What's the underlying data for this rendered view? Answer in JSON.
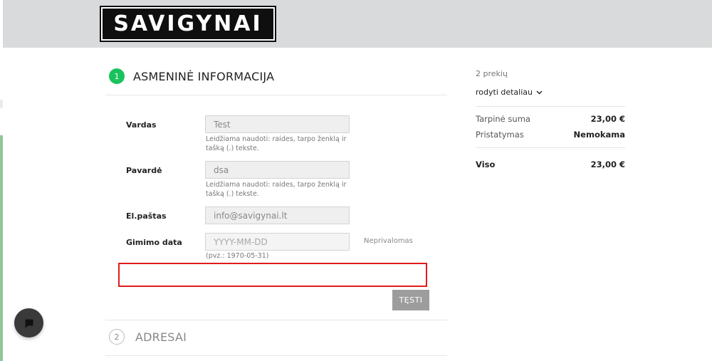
{
  "header": {
    "logo_text": "SAVIGYNAI"
  },
  "steps": [
    {
      "number": "1",
      "title": "ASMENINĖ INFORMACIJA"
    },
    {
      "number": "2",
      "title": "ADRESAI"
    }
  ],
  "form": {
    "first_name": {
      "label": "Vardas",
      "value": "Test",
      "hint": "Leidžiama naudoti: raides, tarpo ženklą ir tašką (.) tekste."
    },
    "last_name": {
      "label": "Pavardė",
      "value": "dsa",
      "hint": "Leidžiama naudoti: raides, tarpo ženklą ir tašką (.) tekste."
    },
    "email": {
      "label": "El.paštas",
      "value": "info@savigynai.lt"
    },
    "birthdate": {
      "label": "Gimimo data",
      "placeholder": "YYYY-MM-DD",
      "hint": "(pvz.: 1970-05-31)",
      "optional": "Neprivalomas"
    },
    "continue_label": "TĘSTI"
  },
  "summary": {
    "item_count": "2 prekių",
    "details_toggle": "rodyti detaliau",
    "subtotal_label": "Tarpinė suma",
    "subtotal_value": "23,00 €",
    "shipping_label": "Pristatymas",
    "shipping_value": "Nemokama",
    "total_label": "Viso",
    "total_value": "23,00 €"
  },
  "icons": {
    "chat": "chat-icon",
    "chevron": "chevron-down-icon"
  },
  "colors": {
    "step_active": "#19c35c",
    "highlight": "#e01b1b",
    "button": "#9d9d9d",
    "header_bg": "#d9dadb"
  }
}
